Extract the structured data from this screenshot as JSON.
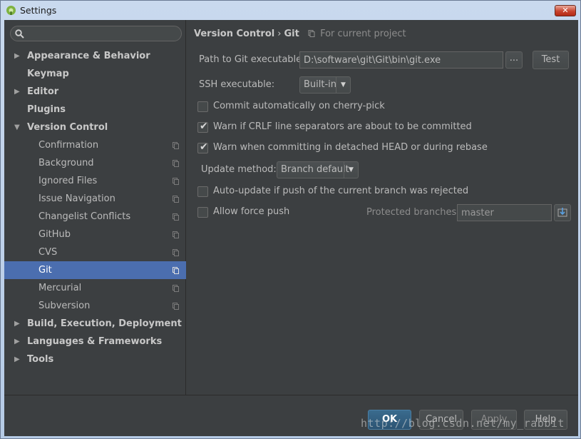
{
  "window": {
    "title": "Settings",
    "close_label": "✕"
  },
  "sidebar": {
    "search_placeholder": "",
    "items": [
      {
        "label": "Appearance & Behavior",
        "level": 0,
        "expandable": true,
        "expanded": false
      },
      {
        "label": "Keymap",
        "level": 0,
        "expandable": false
      },
      {
        "label": "Editor",
        "level": 0,
        "expandable": true,
        "expanded": false
      },
      {
        "label": "Plugins",
        "level": 0,
        "expandable": false
      },
      {
        "label": "Version Control",
        "level": 0,
        "expandable": true,
        "expanded": true
      },
      {
        "label": "Confirmation",
        "level": 1
      },
      {
        "label": "Background",
        "level": 1
      },
      {
        "label": "Ignored Files",
        "level": 1
      },
      {
        "label": "Issue Navigation",
        "level": 1
      },
      {
        "label": "Changelist Conflicts",
        "level": 1
      },
      {
        "label": "GitHub",
        "level": 1
      },
      {
        "label": "CVS",
        "level": 1
      },
      {
        "label": "Git",
        "level": 1,
        "selected": true
      },
      {
        "label": "Mercurial",
        "level": 1
      },
      {
        "label": "Subversion",
        "level": 1
      },
      {
        "label": "Build, Execution, Deployment",
        "level": 0,
        "expandable": true,
        "expanded": false
      },
      {
        "label": "Languages & Frameworks",
        "level": 0,
        "expandable": true,
        "expanded": false
      },
      {
        "label": "Tools",
        "level": 0,
        "expandable": true,
        "expanded": false
      }
    ]
  },
  "breadcrumb": {
    "parent": "Version Control",
    "separator": "›",
    "current": "Git",
    "scope": "For current project"
  },
  "git": {
    "path_label": "Path to Git executable:",
    "path_value": "D:\\software\\git\\Git\\bin\\git.exe",
    "browse_label": "...",
    "test_label": "Test",
    "ssh_label": "SSH executable:",
    "ssh_value": "Built-in",
    "commit_cherry_pick": {
      "label": "Commit automatically on cherry-pick",
      "checked": false
    },
    "warn_crlf": {
      "label": "Warn if CRLF line separators are about to be committed",
      "checked": true
    },
    "warn_detached": {
      "label": "Warn when committing in detached HEAD or during rebase",
      "checked": true
    },
    "update_method_label": "Update method:",
    "update_method_value": "Branch default",
    "auto_update": {
      "label": "Auto-update if push of the current branch was rejected",
      "checked": false
    },
    "allow_force_push": {
      "label": "Allow force push",
      "checked": false
    },
    "protected_branches_label": "Protected branches:",
    "protected_branches_value": "master"
  },
  "footer": {
    "ok": "OK",
    "cancel": "Cancel",
    "apply": "Apply",
    "help": "Help",
    "watermark": "http://blog.csdn.net/my_rabbit"
  },
  "colors": {
    "background": "#3c3f41",
    "selection": "#4b6eaf",
    "text": "#bbbbbb"
  }
}
